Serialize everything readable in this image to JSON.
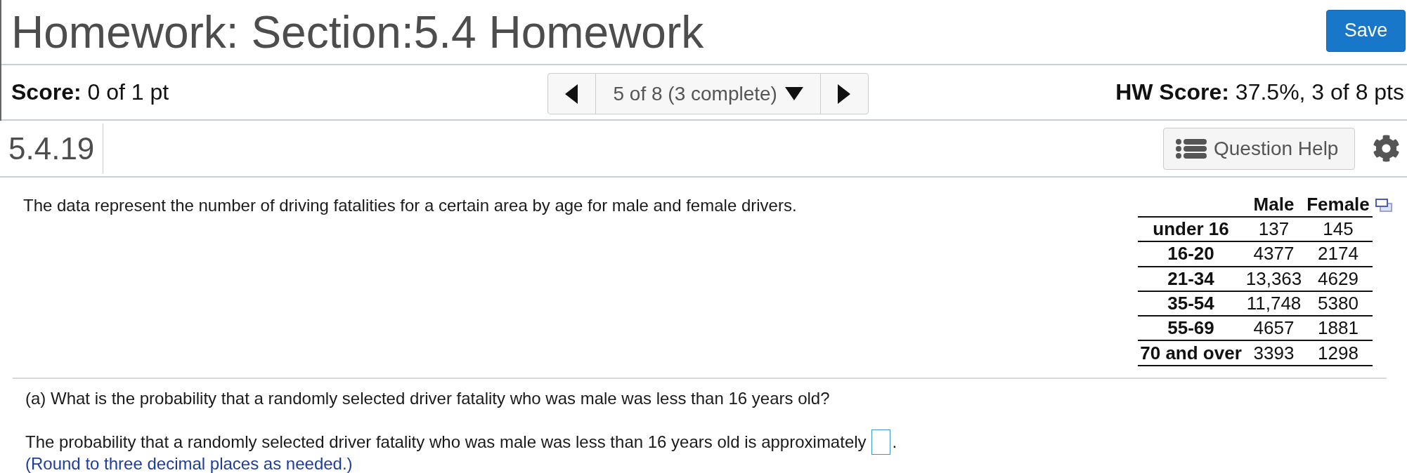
{
  "header": {
    "title": "Homework: Section:5.4 Homework",
    "save_button": "Save"
  },
  "score_bar": {
    "score": "**Score:** 0 of 1 pt",
    "question_selector": "5 of 8 (3 complete)",
    "hw_score": "**HW Score:** 37.5%, 3 of 8 pts"
  },
  "question_bar": {
    "number": "5.4.19",
    "help_button": "Question Help"
  },
  "problem": {
    "text": "The data represent the number of driving fatalities for a certain area by age for male and female drivers.",
    "table": {
      "columns": [
        "Male",
        "Female"
      ],
      "rows": [
        {
          "label": "under 16",
          "values": [
            "137",
            "145"
          ]
        },
        {
          "label": "16-20",
          "values": [
            "4377",
            "2174"
          ]
        },
        {
          "label": "21-34",
          "values": [
            "13,363",
            "4629"
          ]
        },
        {
          "label": "35-54",
          "values": [
            "11,748",
            "5380"
          ]
        },
        {
          "label": "55-69",
          "values": [
            "4657",
            "1881"
          ]
        },
        {
          "label": "70 and over",
          "values": [
            "3393",
            "1298"
          ]
        }
      ]
    }
  },
  "part_a": {
    "question": "(a) What is the probability that a randomly selected driver fatality who was male was less than 16 years old?",
    "answer_prompt": "The probability that a randomly selected driver fatality who was male was less than 16 years old is approximately",
    "answer_suffix": ".",
    "hint": "(Round to three decimal places as needed.)"
  }
}
